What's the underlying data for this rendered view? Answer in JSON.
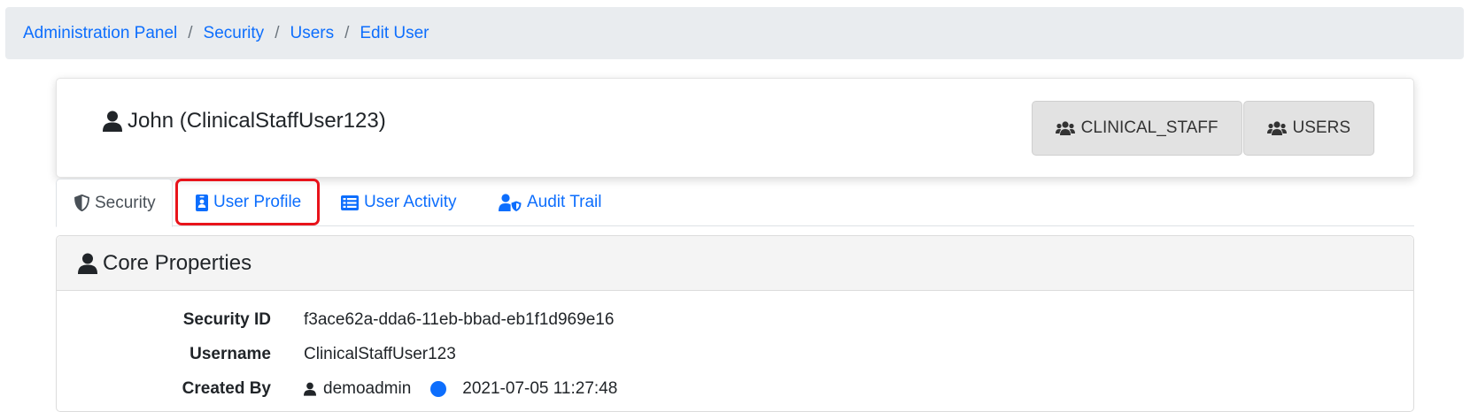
{
  "breadcrumb": {
    "items": [
      "Administration Panel",
      "Security",
      "Users",
      "Edit User"
    ],
    "separator": "/"
  },
  "user": {
    "title": "John (ClinicalStaffUser123)",
    "roles": [
      "CLINICAL_STAFF",
      "USERS"
    ]
  },
  "tabs": [
    {
      "label": "Security",
      "icon": "shield-half-icon",
      "active": true
    },
    {
      "label": "User Profile",
      "icon": "id-badge-icon",
      "active": false,
      "highlighted": true
    },
    {
      "label": "User Activity",
      "icon": "list-icon",
      "active": false
    },
    {
      "label": "Audit Trail",
      "icon": "user-shield-icon",
      "active": false
    }
  ],
  "core": {
    "title": "Core Properties",
    "properties": [
      {
        "label": "Security ID",
        "value": "f3ace62a-dda6-11eb-bbad-eb1f1d969e16"
      },
      {
        "label": "Username",
        "value": "ClinicalStaffUser123"
      },
      {
        "label": "Created By",
        "value": "demoadmin",
        "date": "2021-07-05 11:27:48"
      }
    ]
  },
  "colors": {
    "link": "#0d6efd",
    "highlight": "#e8131b",
    "breadcrumb_bg": "#e9ecef",
    "role_bg": "#e2e2e2"
  }
}
